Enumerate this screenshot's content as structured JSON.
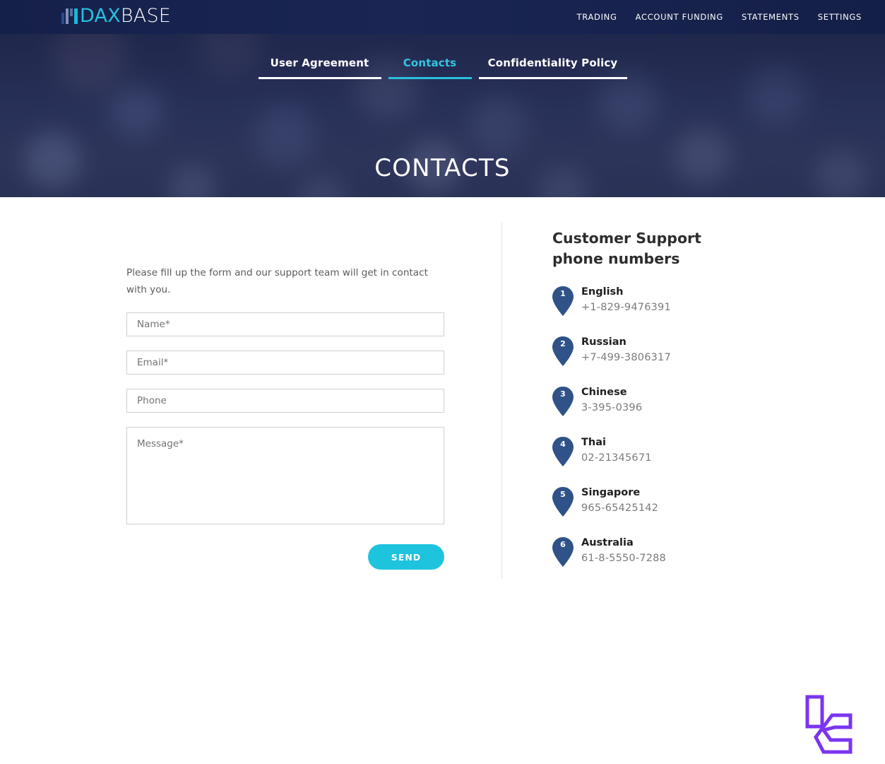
{
  "brand": {
    "logo_dax": "DAX",
    "logo_base": "BASE",
    "accent_cyan": "#27c0de",
    "header_navy": "#18224c"
  },
  "header": {
    "nav": [
      {
        "label": "TRADING"
      },
      {
        "label": "ACCOUNT FUNDING"
      },
      {
        "label": "STATEMENTS"
      },
      {
        "label": "SETTINGS"
      }
    ]
  },
  "hero": {
    "title": "CONTACTS",
    "tabs": [
      {
        "label": "User Agreement",
        "active": false
      },
      {
        "label": "Contacts",
        "active": true
      },
      {
        "label": "Confidentiality Policy",
        "active": false
      }
    ]
  },
  "form": {
    "intro": "Please fill up the form and our support team will get in contact with you.",
    "fields": [
      {
        "name": "name",
        "placeholder": "Name*",
        "value": ""
      },
      {
        "name": "email",
        "placeholder": "Email*",
        "value": ""
      },
      {
        "name": "phone",
        "placeholder": "Phone",
        "value": ""
      }
    ],
    "message": {
      "placeholder": "Message*",
      "value": ""
    },
    "send_label": "SEND"
  },
  "support": {
    "title": "Customer Support phone numbers",
    "numbers": [
      {
        "index": "1",
        "language": "English",
        "phone": "+1-829-9476391"
      },
      {
        "index": "2",
        "language": "Russian",
        "phone": "+7-499-3806317"
      },
      {
        "index": "3",
        "language": "Chinese",
        "phone": "3-395-0396"
      },
      {
        "index": "4",
        "language": "Thai",
        "phone": "02-21345671"
      },
      {
        "index": "5",
        "language": "Singapore",
        "phone": "965-65425142"
      },
      {
        "index": "6",
        "language": "Australia",
        "phone": "61-8-5550-7288"
      }
    ],
    "pin_color": "#2f5288"
  },
  "watermark": {
    "color": "#7a35f0"
  }
}
